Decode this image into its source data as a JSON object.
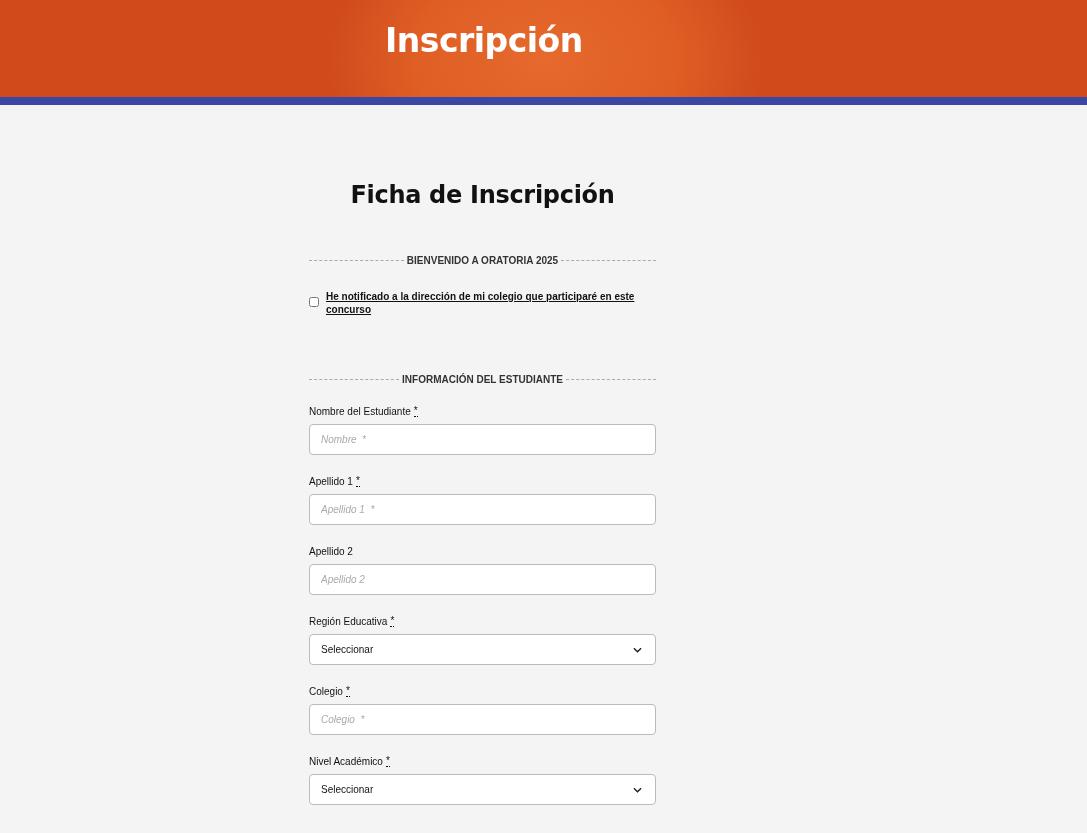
{
  "banner": {
    "title": "Inscripción"
  },
  "form": {
    "title": "Ficha de Inscripción",
    "welcome_section": {
      "heading": "BIENVENIDO A ORATORIA 2025",
      "consent": {
        "label": "He notificado a la dirección de mi colegio que participaré en este concurso",
        "checked": false
      }
    },
    "student_section": {
      "heading": "INFORMACIÓN DEL ESTUDIANTE",
      "fields": [
        {
          "kind": "text",
          "label": "Nombre del Estudiante",
          "required_mark": "*",
          "placeholder": "Nombre  *"
        },
        {
          "kind": "text",
          "label": "Apellido 1",
          "required_mark": "*",
          "placeholder": "Apellido 1  *"
        },
        {
          "kind": "text",
          "label": "Apellido 2",
          "placeholder": "Apellido 2"
        },
        {
          "kind": "select",
          "label": "Región Educativa",
          "required_mark": "*",
          "value": "Seleccionar"
        },
        {
          "kind": "text",
          "label": "Colegio",
          "required_mark": "*",
          "placeholder": "Colegio  *"
        },
        {
          "kind": "select",
          "label": "Nivel Académico",
          "required_mark": "*",
          "value": "Seleccionar"
        }
      ]
    }
  }
}
